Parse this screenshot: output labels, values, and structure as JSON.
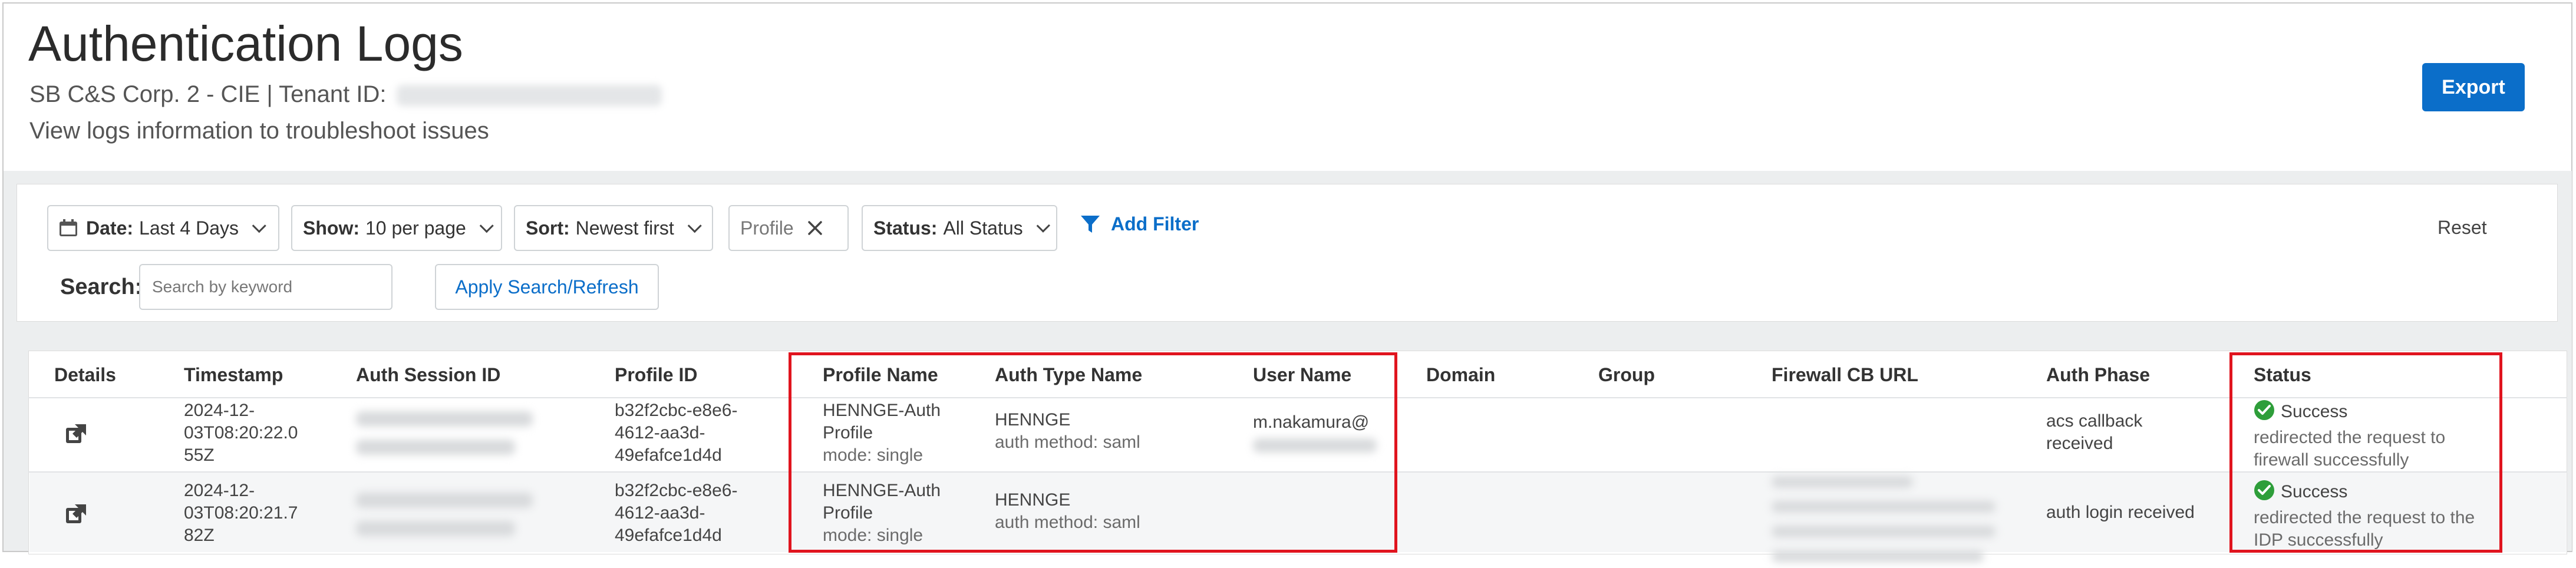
{
  "header": {
    "title": "Authentication Logs",
    "tenant_prefix": "SB C&S Corp. 2 - CIE | Tenant ID:",
    "subtitle": "View logs information to troubleshoot issues",
    "export_label": "Export"
  },
  "filters": {
    "date_label": "Date:",
    "date_value": "Last 4 Days",
    "show_label": "Show:",
    "show_value": "10 per page",
    "sort_label": "Sort:",
    "sort_value": "Newest first",
    "profile_chip": "Profile",
    "status_label": "Status:",
    "status_value": "All Status",
    "add_filter": "Add Filter",
    "reset": "Reset",
    "search_label": "Search:",
    "search_placeholder": "Search by keyword",
    "apply_label": "Apply Search/Refresh"
  },
  "table": {
    "columns": [
      "Details",
      "Timestamp",
      "Auth Session ID",
      "Profile ID",
      "Profile Name",
      "Auth Type Name",
      "User Name",
      "Domain",
      "Group",
      "Firewall CB URL",
      "Auth Phase",
      "Status"
    ],
    "rows": [
      {
        "timestamp": [
          "2024-12-",
          "03T08:20:22.0",
          "55Z"
        ],
        "profile_id": [
          "b32f2cbc-e8e6-",
          "4612-aa3d-",
          "49efafce1d4d"
        ],
        "profile_name": [
          "HENNGE-Auth",
          "Profile"
        ],
        "profile_mode": "mode: single",
        "auth_type": "HENNGE",
        "auth_method": "auth method: saml",
        "user_name": "m.nakamura@",
        "auth_phase": [
          "acs callback",
          "received"
        ],
        "status": "Success",
        "status_detail": [
          "redirected the request to",
          "firewall successfully"
        ]
      },
      {
        "timestamp": [
          "2024-12-",
          "03T08:20:21.7",
          "82Z"
        ],
        "profile_id": [
          "b32f2cbc-e8e6-",
          "4612-aa3d-",
          "49efafce1d4d"
        ],
        "profile_name": [
          "HENNGE-Auth",
          "Profile"
        ],
        "profile_mode": "mode: single",
        "auth_type": "HENNGE",
        "auth_method": "auth method: saml",
        "user_name": "",
        "auth_phase": [
          "auth login received"
        ],
        "status": "Success",
        "status_detail": [
          "redirected the request to the",
          "IDP successfully"
        ]
      }
    ]
  },
  "colors": {
    "accent": "#0b6ec9",
    "success": "#2e9e3a",
    "highlight": "#e0141e"
  }
}
